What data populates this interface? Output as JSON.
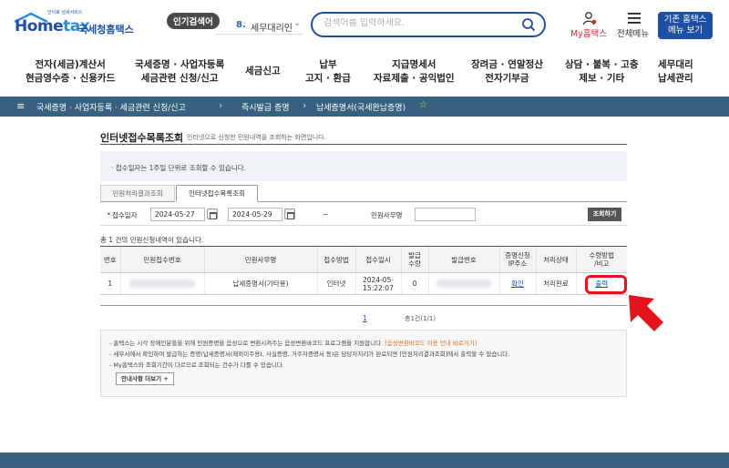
{
  "header": {
    "logo_tag": "안이로 넘세서비스",
    "logo_home": "Home",
    "logo_tax": "tax",
    "logo_kr": "국세청홈택스",
    "popular_label": "인기검색어",
    "popular_rank": "8.",
    "popular_term": "세무대리인",
    "search_placeholder": "검색어를 입력하세요.",
    "my_label": "My홈택스",
    "menu_label": "전체메뉴",
    "classic_line1": "기존 홈택스",
    "classic_line2": "메뉴 보기"
  },
  "gnb": [
    {
      "l1": "전자(세금)계산서",
      "l2": "현금영수증 · 신용카드"
    },
    {
      "l1": "국세증명 · 사업자등록",
      "l2": "세금관련 신청/신고"
    },
    {
      "l1": "세금신고",
      "l2": ""
    },
    {
      "l1": "납부",
      "l2": "고지 · 환급"
    },
    {
      "l1": "지급명세서",
      "l2": "자료제출 · 공익법인"
    },
    {
      "l1": "장려금 · 연말정산",
      "l2": "전자기부금"
    },
    {
      "l1": "상담 · 불복 · 고충",
      "l2": "제보 · 기타"
    },
    {
      "l1": "세무대리",
      "l2": "납세관리"
    }
  ],
  "breadcrumb": {
    "c1": "국세증명 · 사업자등록 · 세금관련 신청/신고",
    "c2": "즉시발급 증명",
    "c3": "납세증명서(국세완납증명)"
  },
  "page": {
    "title": "인터넷접수목록조회",
    "desc": "인터넷으로 신청한 민원내역을 조회하는 화면입니다.",
    "notice": "· 접수일자는 1주일 단위로 조회할 수 있습니다.",
    "tab_inactive": "민원처리결과조회",
    "tab_active": "인터넷접수목록조회"
  },
  "filter": {
    "date_label": "접수일자",
    "date_from": "2024-05-27",
    "tilde": "~",
    "date_to": "2024-05-29",
    "name_label": "민원사무명",
    "search_button": "조회하기"
  },
  "results": {
    "count_text": "총 1 건의 민원신청내역이 있습니다.",
    "headers": [
      "번호",
      "민원접수번호",
      "민원사무명",
      "접수방법",
      "접수일시",
      "발급\n수량",
      "발급번호",
      "증명신청\nIP주소",
      "처리상태",
      "수령방법\n/비고"
    ],
    "rows": [
      {
        "no": "1",
        "name": "납세증명서(기타용)",
        "method": "인터넷",
        "date": "2024-05-",
        "time": "15:22:07",
        "qty": "0",
        "ip_link": "확인",
        "status": "처리완료",
        "output_link": "출력"
      }
    ]
  },
  "pager": {
    "current": "1",
    "total": "총1건(1/1)"
  },
  "info": {
    "line1_a": "- 홈택스는 시각 장애인분들을 위해 민원증명을 음성으로 변환시켜주는 음성변환바코드 프로그램을 지원합니다.",
    "line1_b": "[음성변환바코드 이용 안내 바로가기]",
    "line2": "- 세무서에서 확인하여 발급하는 증명(납세증명서(해외이주용), 사실증명, 거주자증명서 등)은 담당자처리가 완료되면 [민원처리결과조회]에서 출력할 수 있습니다.",
    "line3": "- My홈택스와 조회기간이 다르므로 조회되는 건수가 다를 수 있습니다.",
    "more_button": "안내사항 더보기 +"
  },
  "colors": {
    "brand_blue": "#1f4fa3",
    "bar_teal": "#37617f",
    "highlight_red": "#e3141b"
  }
}
